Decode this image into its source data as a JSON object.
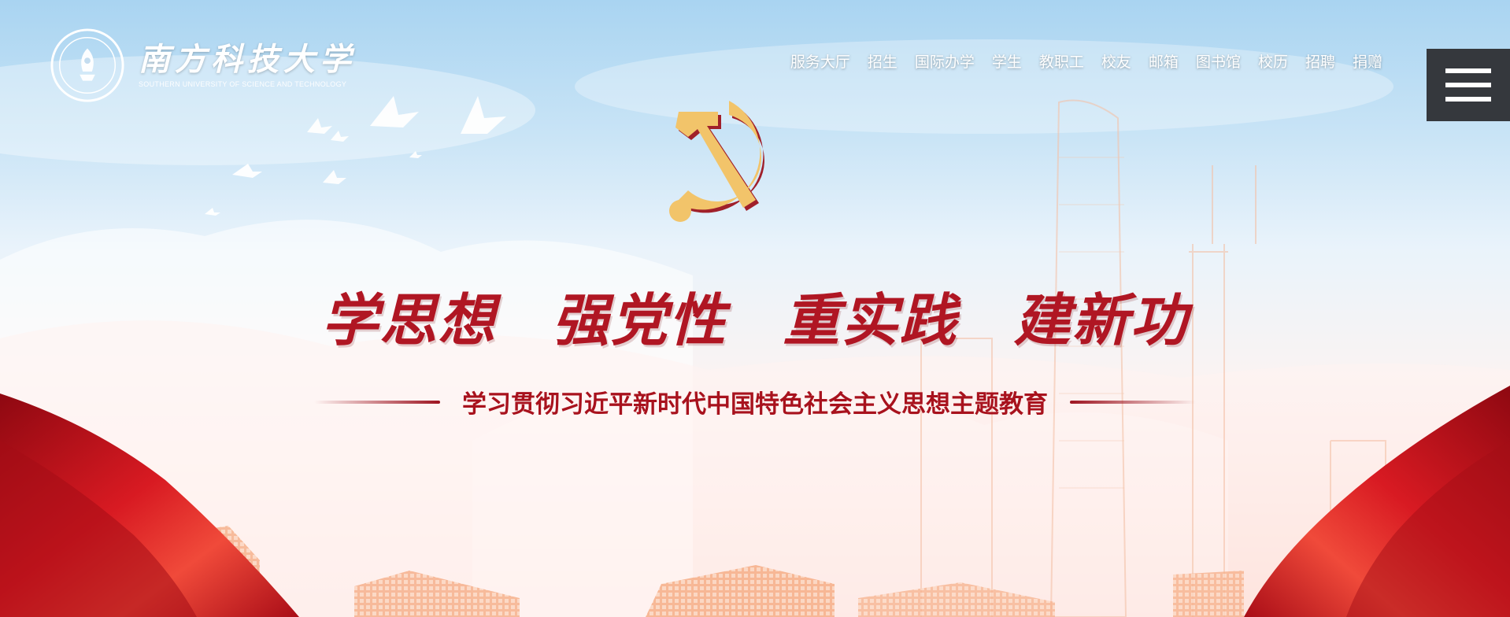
{
  "header": {
    "logo_cn": "南方科技大学",
    "logo_en": "SOUTHERN UNIVERSITY OF SCIENCE AND TECHNOLOGY"
  },
  "nav": {
    "items": [
      {
        "label": "服务大厅"
      },
      {
        "label": "招生"
      },
      {
        "label": "国际办学"
      },
      {
        "label": "学生"
      },
      {
        "label": "教职工"
      },
      {
        "label": "校友"
      },
      {
        "label": "邮箱"
      },
      {
        "label": "图书馆"
      },
      {
        "label": "校历"
      },
      {
        "label": "招聘"
      },
      {
        "label": "捐赠"
      }
    ]
  },
  "menu": {
    "icon": "hamburger-menu-icon"
  },
  "banner": {
    "emblem_icon": "hammer-sickle-icon",
    "slogan": [
      "学思想",
      "强党性",
      "重实践",
      "建新功"
    ],
    "subtitle": "学习贯彻习近平新时代中国特色社会主义思想主题教育"
  },
  "colors": {
    "slogan_red": "#b01623",
    "emblem_gold": "#f2c46a",
    "menu_bg": "#35383d",
    "ribbon_red": "#c3101b"
  }
}
